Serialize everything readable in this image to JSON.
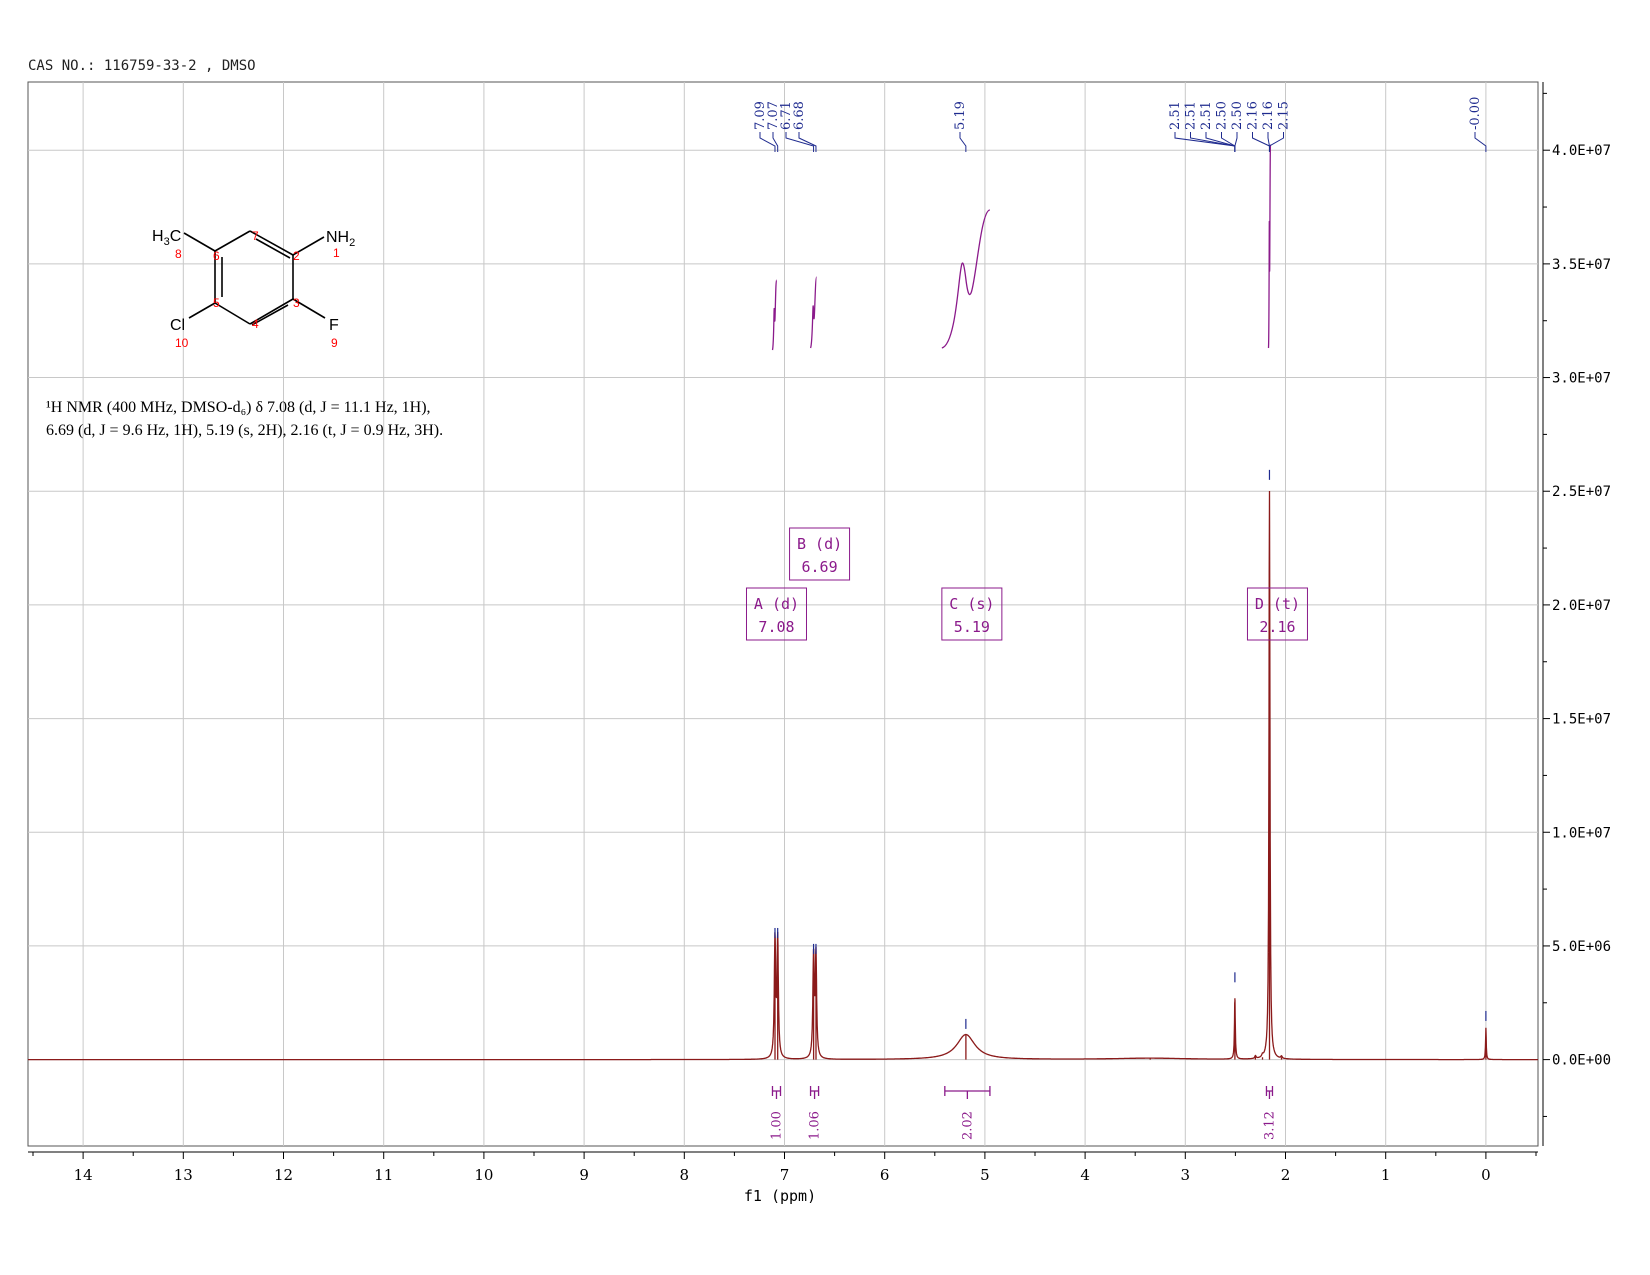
{
  "header": {
    "cas_label": "CAS NO.: 116759-33-2 , DMSO"
  },
  "nmr_description": {
    "line1": "¹H NMR (400 MHz, DMSO-d₆) δ 7.08 (d, J = 11.1 Hz, 1H),",
    "line2": "6.69 (d, J = 9.6 Hz, 1H), 5.19 (s, 2H), 2.16 (t, J = 0.9 Hz, 3H)."
  },
  "structure": {
    "atoms": [
      {
        "label": "H3C",
        "number": "8"
      },
      {
        "label": "NH2",
        "number": "1"
      },
      {
        "label": "Cl",
        "number": "10"
      },
      {
        "label": "F",
        "number": "9"
      }
    ],
    "ring_numbers": [
      "7",
      "2",
      "6",
      "5",
      "3",
      "4"
    ]
  },
  "chart_data": {
    "type": "line",
    "xlabel": "f1 (ppm)",
    "xlim": [
      14.55,
      -0.52
    ],
    "x_ticks": [
      14,
      13,
      12,
      11,
      10,
      9,
      8,
      7,
      6,
      5,
      4,
      3,
      2,
      1,
      0
    ],
    "ylim": [
      -3800000,
      43000000
    ],
    "y_ticks": [
      0,
      5000000,
      10000000,
      15000000,
      20000000,
      25000000,
      30000000,
      35000000,
      40000000
    ],
    "y_tick_labels": [
      "0.0E+00",
      "5.0E+06",
      "1.0E+07",
      "1.5E+07",
      "2.0E+07",
      "2.5E+07",
      "3.0E+07",
      "3.5E+07",
      "4.0E+07"
    ],
    "grid": true,
    "peaks": [
      {
        "ppm": 7.095,
        "height": 5200000,
        "width": 0.008
      },
      {
        "ppm": 7.068,
        "height": 5200000,
        "width": 0.008
      },
      {
        "ppm": 6.71,
        "height": 4500000,
        "width": 0.008
      },
      {
        "ppm": 6.686,
        "height": 4500000,
        "width": 0.008
      },
      {
        "ppm": 5.19,
        "height": 1100000,
        "width": 0.11
      },
      {
        "ppm": 2.505,
        "height": 2700000,
        "width": 0.005
      },
      {
        "ppm": 2.16,
        "height": 25000000,
        "width": 0.006
      },
      {
        "ppm": 2.3,
        "height": 120000,
        "width": 0.008
      },
      {
        "ppm": 2.23,
        "height": 100000,
        "width": 0.008
      },
      {
        "ppm": 2.04,
        "height": 100000,
        "width": 0.008
      },
      {
        "ppm": 0.0,
        "height": 1400000,
        "width": 0.004
      },
      {
        "ppm": 3.35,
        "height": 60000,
        "width": 0.45
      }
    ],
    "peak_labels": {
      "group1": [
        "7.09",
        "7.07",
        "6.71",
        "6.68"
      ],
      "group2": [
        "5.19"
      ],
      "group3": [
        "2.51",
        "2.51",
        "2.51",
        "2.50",
        "2.50",
        "2.16",
        "2.16",
        "2.15"
      ],
      "group4": [
        "-0.00"
      ]
    },
    "multiplets": [
      {
        "id": "A",
        "mult": "d",
        "shift": "7.08"
      },
      {
        "id": "B",
        "mult": "d",
        "shift": "6.69"
      },
      {
        "id": "C",
        "mult": "s",
        "shift": "5.19"
      },
      {
        "id": "D",
        "mult": "t",
        "shift": "2.16"
      }
    ],
    "integrals": [
      {
        "from": 7.12,
        "to": 7.04,
        "value": "1.00"
      },
      {
        "from": 6.74,
        "to": 6.66,
        "value": "1.06"
      },
      {
        "from": 5.4,
        "to": 4.95,
        "value": "2.02"
      },
      {
        "from": 2.19,
        "to": 2.13,
        "value": "3.12"
      }
    ],
    "colors": {
      "spectrum": "#8b1a1a",
      "peak_label": "#1f2b8f",
      "integral": "#8b1a8b",
      "grid": "#c8c8c8",
      "atom_number": "#ff0000"
    }
  }
}
